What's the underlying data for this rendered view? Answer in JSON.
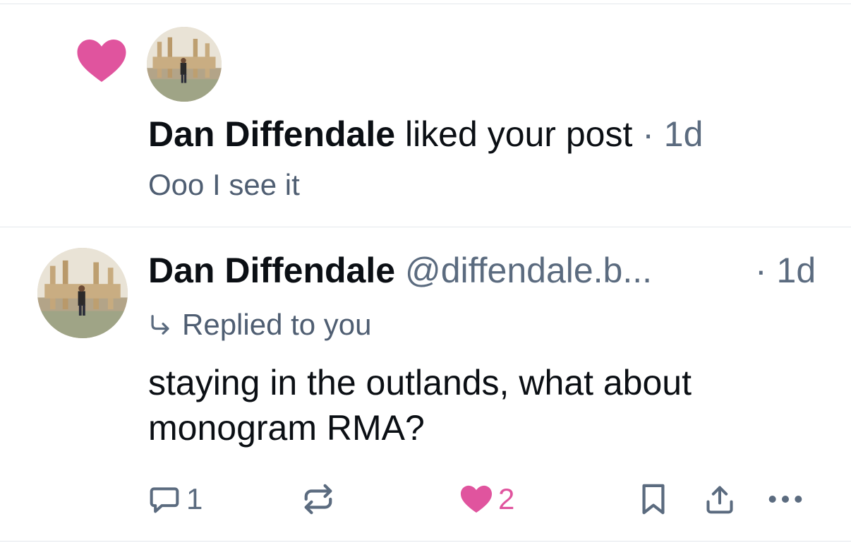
{
  "notification": {
    "author": "Dan Diffendale",
    "action_text": "liked your post",
    "separator": " · ",
    "time": "1d",
    "post_preview": "Ooo I see it"
  },
  "post": {
    "author": "Dan Diffendale",
    "handle": "@diffendale.b...",
    "time": "· 1d",
    "reply_context": "Replied to you",
    "text": "staying in the outlands, what about monogram RMA?",
    "actions": {
      "reply_count": "1",
      "like_count": "2"
    }
  },
  "icons": {
    "notification_type": "heart-icon",
    "reply_context": "reply-arrow-icon",
    "reply": "speech-bubble-icon",
    "repost": "repost-icon",
    "like": "heart-icon",
    "bookmark": "bookmark-icon",
    "share": "share-icon",
    "more": "ellipsis-icon"
  },
  "colors": {
    "like": "#e0549e",
    "muted_text": "#5b6b7f",
    "divider": "#e3e7ec"
  }
}
